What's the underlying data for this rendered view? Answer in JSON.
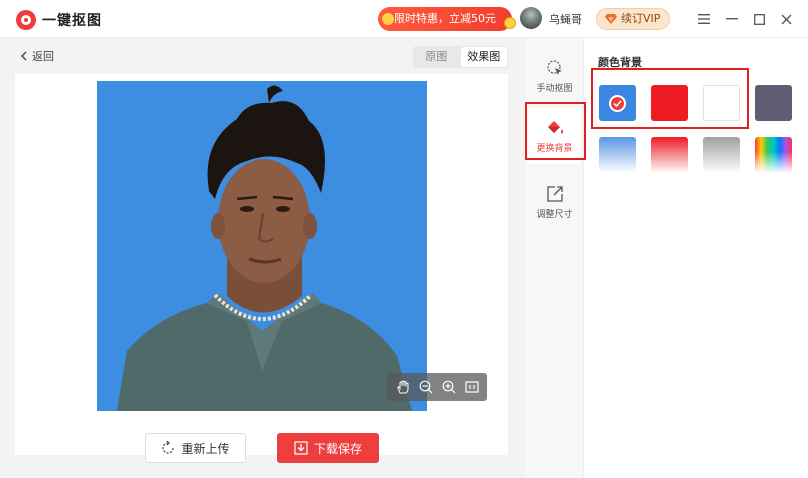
{
  "app": {
    "name": "一键抠图"
  },
  "header": {
    "promo_label": "限时特惠，立减50元",
    "username": "乌蝇哥",
    "vip_label": "续订VIP"
  },
  "workspace": {
    "back_label": "返回",
    "view_toggle": [
      {
        "label": "原图",
        "active": false
      },
      {
        "label": "效果图",
        "active": true
      }
    ],
    "photo_background_color": "#3d8de0",
    "canvas_tools": [
      "hand-icon",
      "zoom-out-icon",
      "zoom-in-icon",
      "fit-screen-icon"
    ],
    "reupload_label": "重新上传",
    "save_label": "下载保存"
  },
  "rail": {
    "items": [
      {
        "label": "手动抠图",
        "icon": "cursor-click-icon",
        "active": false
      },
      {
        "label": "更换背景",
        "icon": "paint-bucket-icon",
        "active": true
      },
      {
        "label": "调整尺寸",
        "icon": "resize-icon",
        "active": false
      }
    ]
  },
  "panel": {
    "title": "颜色背景",
    "solid_swatches": [
      {
        "color": "#3a86e0",
        "selected": true
      },
      {
        "color": "#ee1b23",
        "selected": false
      },
      {
        "color": "#ffffff",
        "selected": false
      },
      {
        "color": "#5e5d73",
        "selected": false
      }
    ],
    "gradient_swatches": [
      {
        "from": "#5a97e6",
        "to": "#ffffff"
      },
      {
        "from": "#ee1b23",
        "to": "#ffffff"
      },
      {
        "from": "#a0a0a0",
        "to": "#ffffff"
      },
      {
        "from": "rainbow",
        "to": "#ffffff"
      }
    ]
  },
  "colors": {
    "accent": "#ef3e3e",
    "highlight_border": "#e02020"
  }
}
